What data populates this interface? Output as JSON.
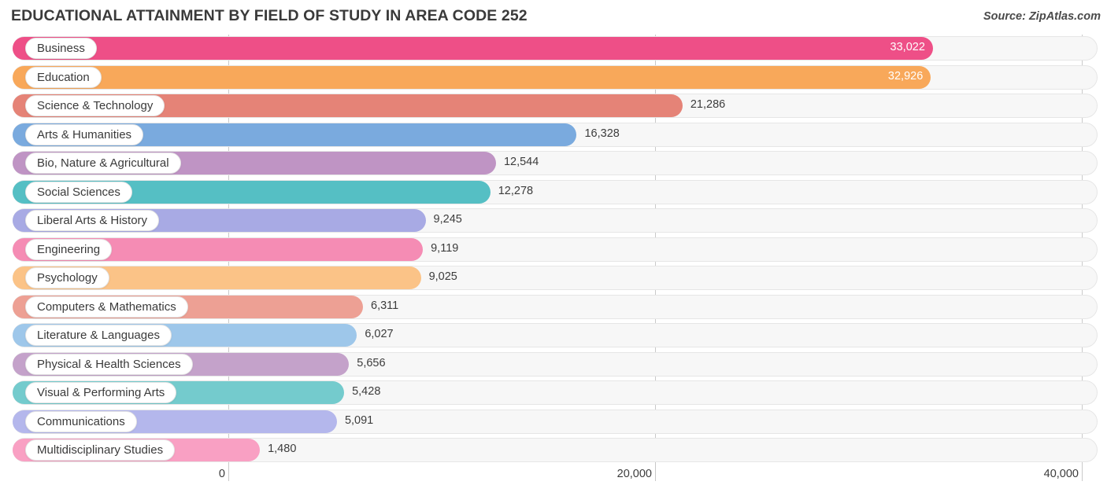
{
  "header": {
    "title": "EDUCATIONAL ATTAINMENT BY FIELD OF STUDY IN AREA CODE 252",
    "source": "Source: ZipAtlas.com"
  },
  "chart_data": {
    "type": "bar",
    "orientation": "horizontal",
    "title": "EDUCATIONAL ATTAINMENT BY FIELD OF STUDY IN AREA CODE 252",
    "xlabel": "",
    "ylabel": "",
    "xlim": [
      0,
      40000
    ],
    "grid": true,
    "legend": "none",
    "xticks": [
      "0",
      "20,000",
      "40,000"
    ],
    "xtick_values": [
      0,
      20000,
      40000
    ],
    "categories": [
      "Business",
      "Education",
      "Science & Technology",
      "Arts & Humanities",
      "Bio, Nature & Agricultural",
      "Social Sciences",
      "Liberal Arts & History",
      "Engineering",
      "Psychology",
      "Computers & Mathematics",
      "Literature & Languages",
      "Physical & Health Sciences",
      "Visual & Performing Arts",
      "Communications",
      "Multidisciplinary Studies"
    ],
    "values": [
      33022,
      32926,
      21286,
      16328,
      12544,
      12278,
      9245,
      9119,
      9025,
      6311,
      6027,
      5656,
      5428,
      5091,
      1480
    ],
    "value_labels": [
      "33,022",
      "32,926",
      "21,286",
      "16,328",
      "12,544",
      "12,278",
      "9,245",
      "9,119",
      "9,025",
      "6,311",
      "6,027",
      "5,656",
      "5,428",
      "5,091",
      "1,480"
    ],
    "colors": [
      "#ee4f87",
      "#f8a councilor",
      "#e58377",
      "#7aaade",
      "#bf94c4",
      "#55bfc4",
      "#a8aae4",
      "#f58cb4",
      "#fbc387",
      "#eda094",
      "#9ec7ea",
      "#c4a2ca",
      "#74cbcd",
      "#b4b7ec",
      "#f9a0c3"
    ],
    "bar_colors": [
      "#ee4f87",
      "#f8a council",
      "#e58377",
      "#7aaade",
      "#bf94c4",
      "#55bfc4",
      "#a8aae4",
      "#f58cb4",
      "#fbc387",
      "#eda094",
      "#9ec7ea",
      "#c4a2ca",
      "#74cbcd",
      "#b4b7ec",
      "#f9a0c3"
    ]
  },
  "palette": [
    "#ee4f87",
    "#f9a council",
    "#e58377",
    "#7aaade",
    "#bf94c4",
    "#55bfc4",
    "#a8aae4",
    "#f58cb4",
    "#fbc387",
    "#eda094",
    "#9ec7ea",
    "#c4a2ca",
    "#74cbcd",
    "#b4b7ec",
    "#f9a0c3"
  ],
  "axis": {
    "ticks": [
      "0",
      "20,000",
      "40,000"
    ]
  }
}
